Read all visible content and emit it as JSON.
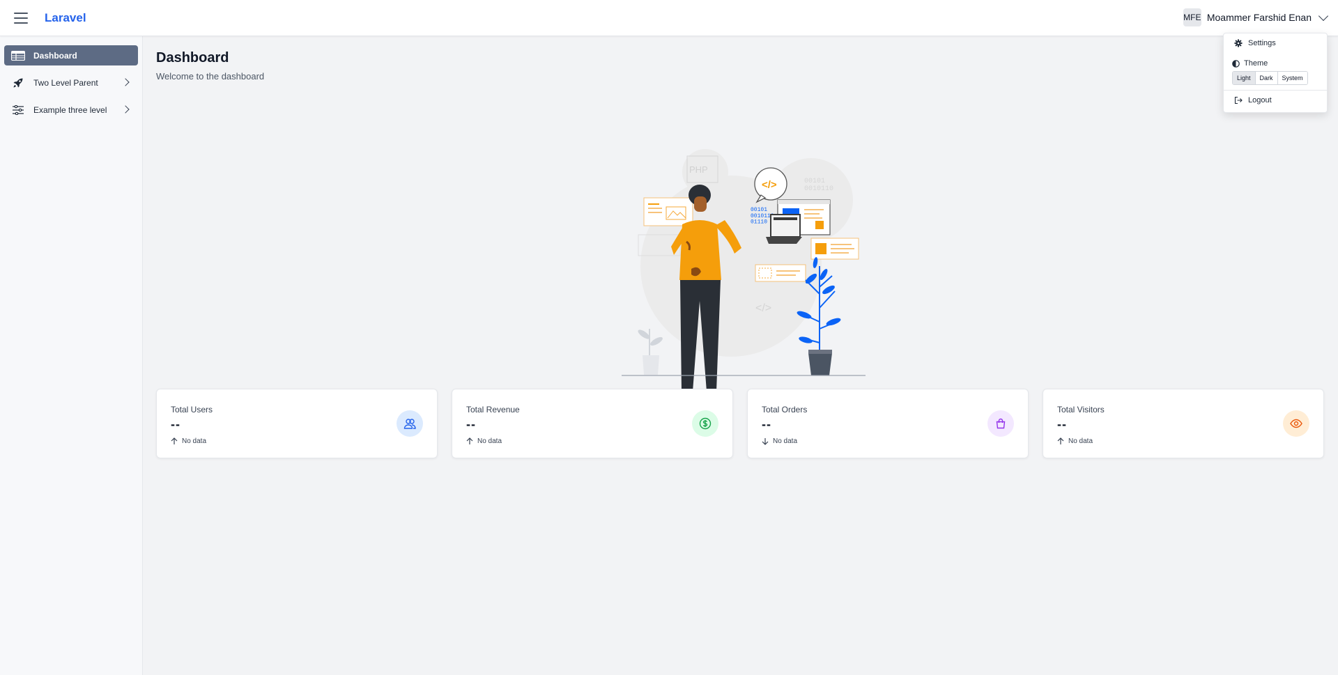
{
  "header": {
    "brand": "Laravel",
    "user": {
      "initials": "MFE",
      "name": "Moammer Farshid Enan"
    }
  },
  "sidebar": {
    "items": [
      {
        "label": "Dashboard",
        "icon": "table-icon",
        "active": true
      },
      {
        "label": "Two Level Parent",
        "icon": "rocket-icon",
        "has_children": true
      },
      {
        "label": "Example three level",
        "icon": "sliders-icon",
        "has_children": true
      }
    ]
  },
  "main": {
    "title": "Dashboard",
    "subtitle": "Welcome to the dashboard",
    "cards": [
      {
        "title": "Total Users",
        "value": "--",
        "trend": "No data",
        "trend_dir": "up",
        "icon": "users-icon",
        "icon_bg": "#dbeafe",
        "icon_color": "#2563eb"
      },
      {
        "title": "Total Revenue",
        "value": "--",
        "trend": "No data",
        "trend_dir": "up",
        "icon": "dollar-icon",
        "icon_bg": "#dcfce7",
        "icon_color": "#16a34a"
      },
      {
        "title": "Total Orders",
        "value": "--",
        "trend": "No data",
        "trend_dir": "down",
        "icon": "shopping-bag-icon",
        "icon_bg": "#f3e8ff",
        "icon_color": "#9333ea"
      },
      {
        "title": "Total Visitors",
        "value": "--",
        "trend": "No data",
        "trend_dir": "up",
        "icon": "eye-icon",
        "icon_bg": "#ffedd5",
        "icon_color": "#ea580c"
      }
    ]
  },
  "dropdown": {
    "settings": "Settings",
    "theme": "Theme",
    "theme_options": [
      "Light",
      "Dark",
      "System"
    ],
    "selected_theme": "Light",
    "logout": "Logout"
  },
  "illustration": {
    "code_bits": "00101\n0010110\n01110",
    "bg_bits": "00101\n0010110",
    "php": "PHP"
  },
  "colors": {
    "accent": "#2563eb",
    "active_nav": "#5d6b84",
    "illustration_orange": "#f59e0b",
    "illustration_blue": "#0b63f6"
  }
}
